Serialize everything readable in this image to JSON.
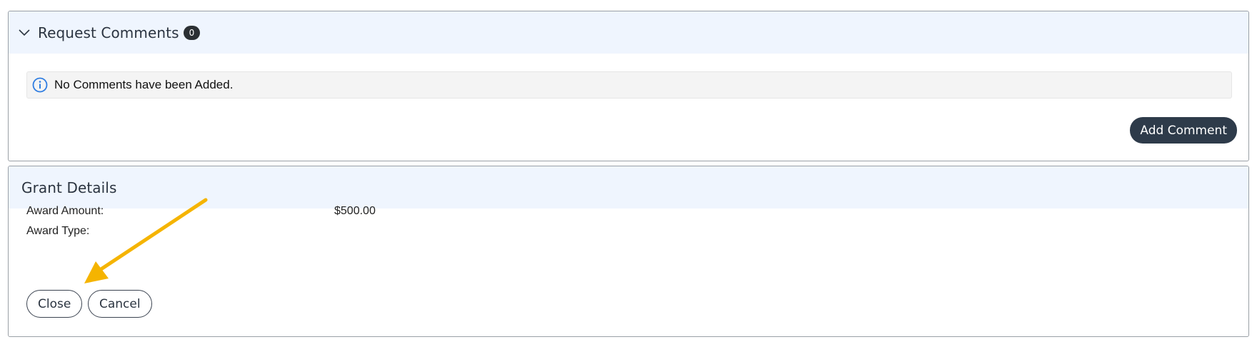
{
  "comments": {
    "title": "Request Comments",
    "count": "0",
    "empty_message": "No Comments have been Added.",
    "add_button": "Add Comment",
    "icons": {
      "collapse": "chevron-down-icon",
      "info": "info-circle-icon"
    }
  },
  "grant": {
    "title": "Grant Details",
    "fields": [
      {
        "label": "Award Amount:",
        "value": "$500.00"
      },
      {
        "label": "Award Type:",
        "value": ""
      }
    ],
    "close_button": "Close",
    "cancel_button": "Cancel"
  },
  "annotation": {
    "arrow_color": "#f5b400",
    "target": "close-button"
  },
  "colors": {
    "header_bg": "#eff5fe",
    "dark_button": "#2e3b4a",
    "info_icon": "#2f7de1"
  }
}
